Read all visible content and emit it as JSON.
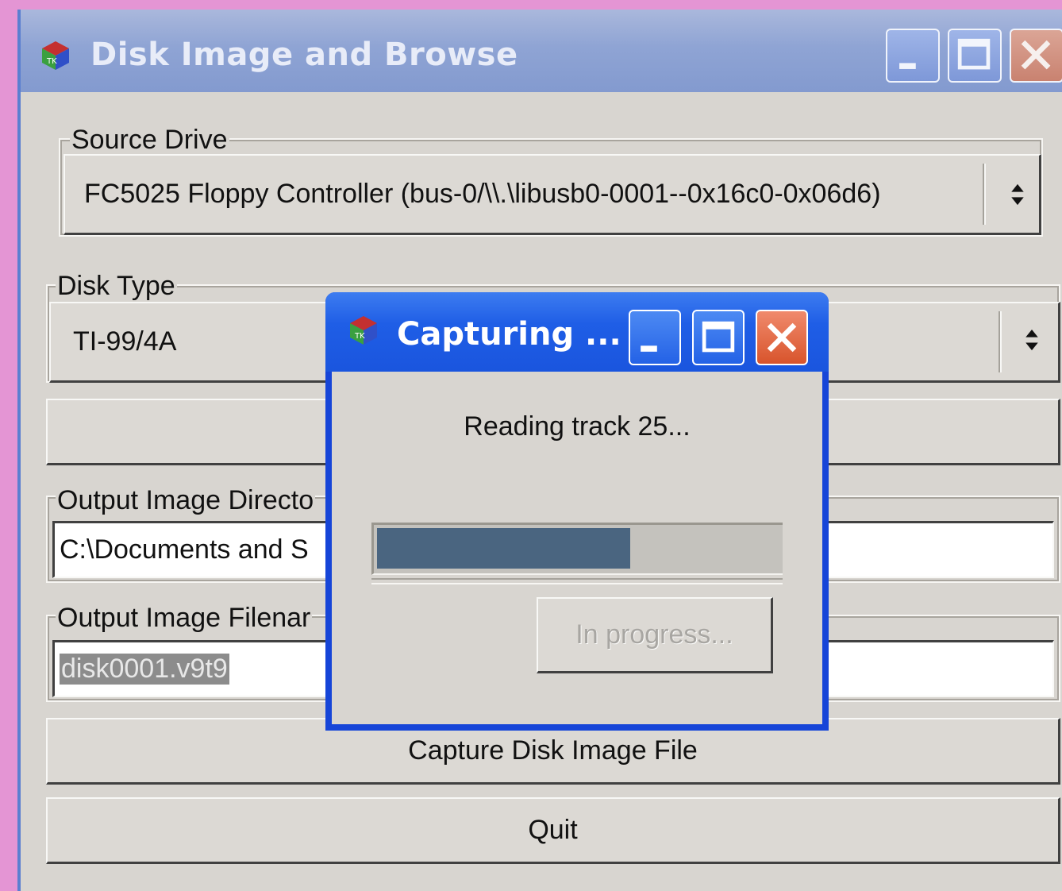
{
  "main_window": {
    "title": "Disk Image and Browse",
    "source_drive": {
      "label": "Source Drive",
      "selected": "FC5025 Floppy Controller (bus-0/\\\\.\\libusb0-0001--0x16c0-0x06d6)"
    },
    "disk_type": {
      "label": "Disk Type",
      "selected": "TI-99/4A"
    },
    "output_dir": {
      "label": "Output Image Directo",
      "value": "C:\\Documents and S"
    },
    "output_filename": {
      "label": "Output Image Filenar",
      "value": "disk0001.v9t9"
    },
    "capture_button": "Capture Disk Image File",
    "quit_button": "Quit"
  },
  "dialog": {
    "title": "Capturing ...",
    "status": "Reading track 25...",
    "progress_fraction": 0.63,
    "button": "In progress..."
  },
  "colors": {
    "desktop": "#e495d4",
    "window_bg": "#d8d5d0",
    "inactive_titlebar": "#8fa4d4",
    "active_titlebar": "#1f5ee6",
    "progress_fill": "#4a6580"
  },
  "icons": {
    "app": "gtk-cube-icon",
    "minimize": "minimize-icon",
    "maximize": "maximize-icon",
    "close": "close-icon",
    "combo_arrows": "updown-arrows-icon"
  }
}
